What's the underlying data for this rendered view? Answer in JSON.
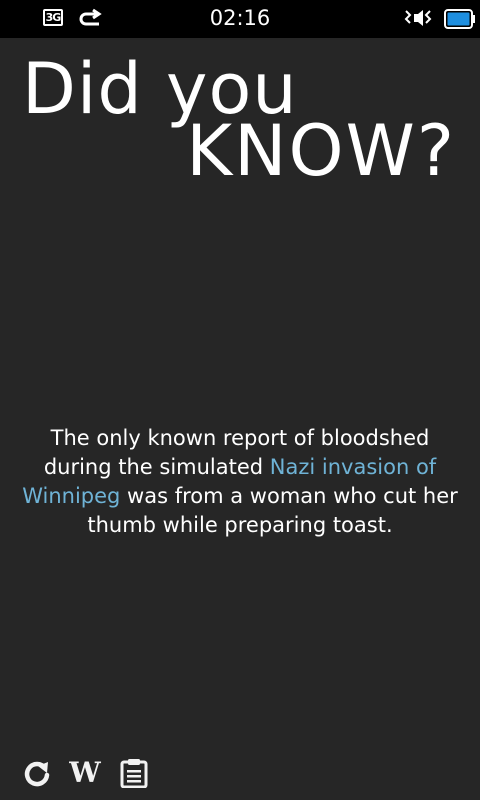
{
  "status_bar": {
    "network": "3G",
    "time": "02:16",
    "icons": [
      "3g-icon",
      "sync-icon",
      "vibrate-icon",
      "battery-icon"
    ]
  },
  "title": {
    "line1": "Did you",
    "line2": "KNOW?"
  },
  "fact": {
    "before": "The only known report of bloodshed during the simulated ",
    "link": "Nazi invasion of Winnipeg",
    "after": " was from a woman who cut her thumb while preparing toast."
  },
  "toolbar": {
    "wiki_label": "W",
    "icons": [
      "refresh-icon",
      "wikipedia-icon",
      "clipboard-icon"
    ]
  },
  "colors": {
    "background": "#262626",
    "status_bar": "#000000",
    "link": "#6fb3d6",
    "battery": "#1e8fe0"
  }
}
